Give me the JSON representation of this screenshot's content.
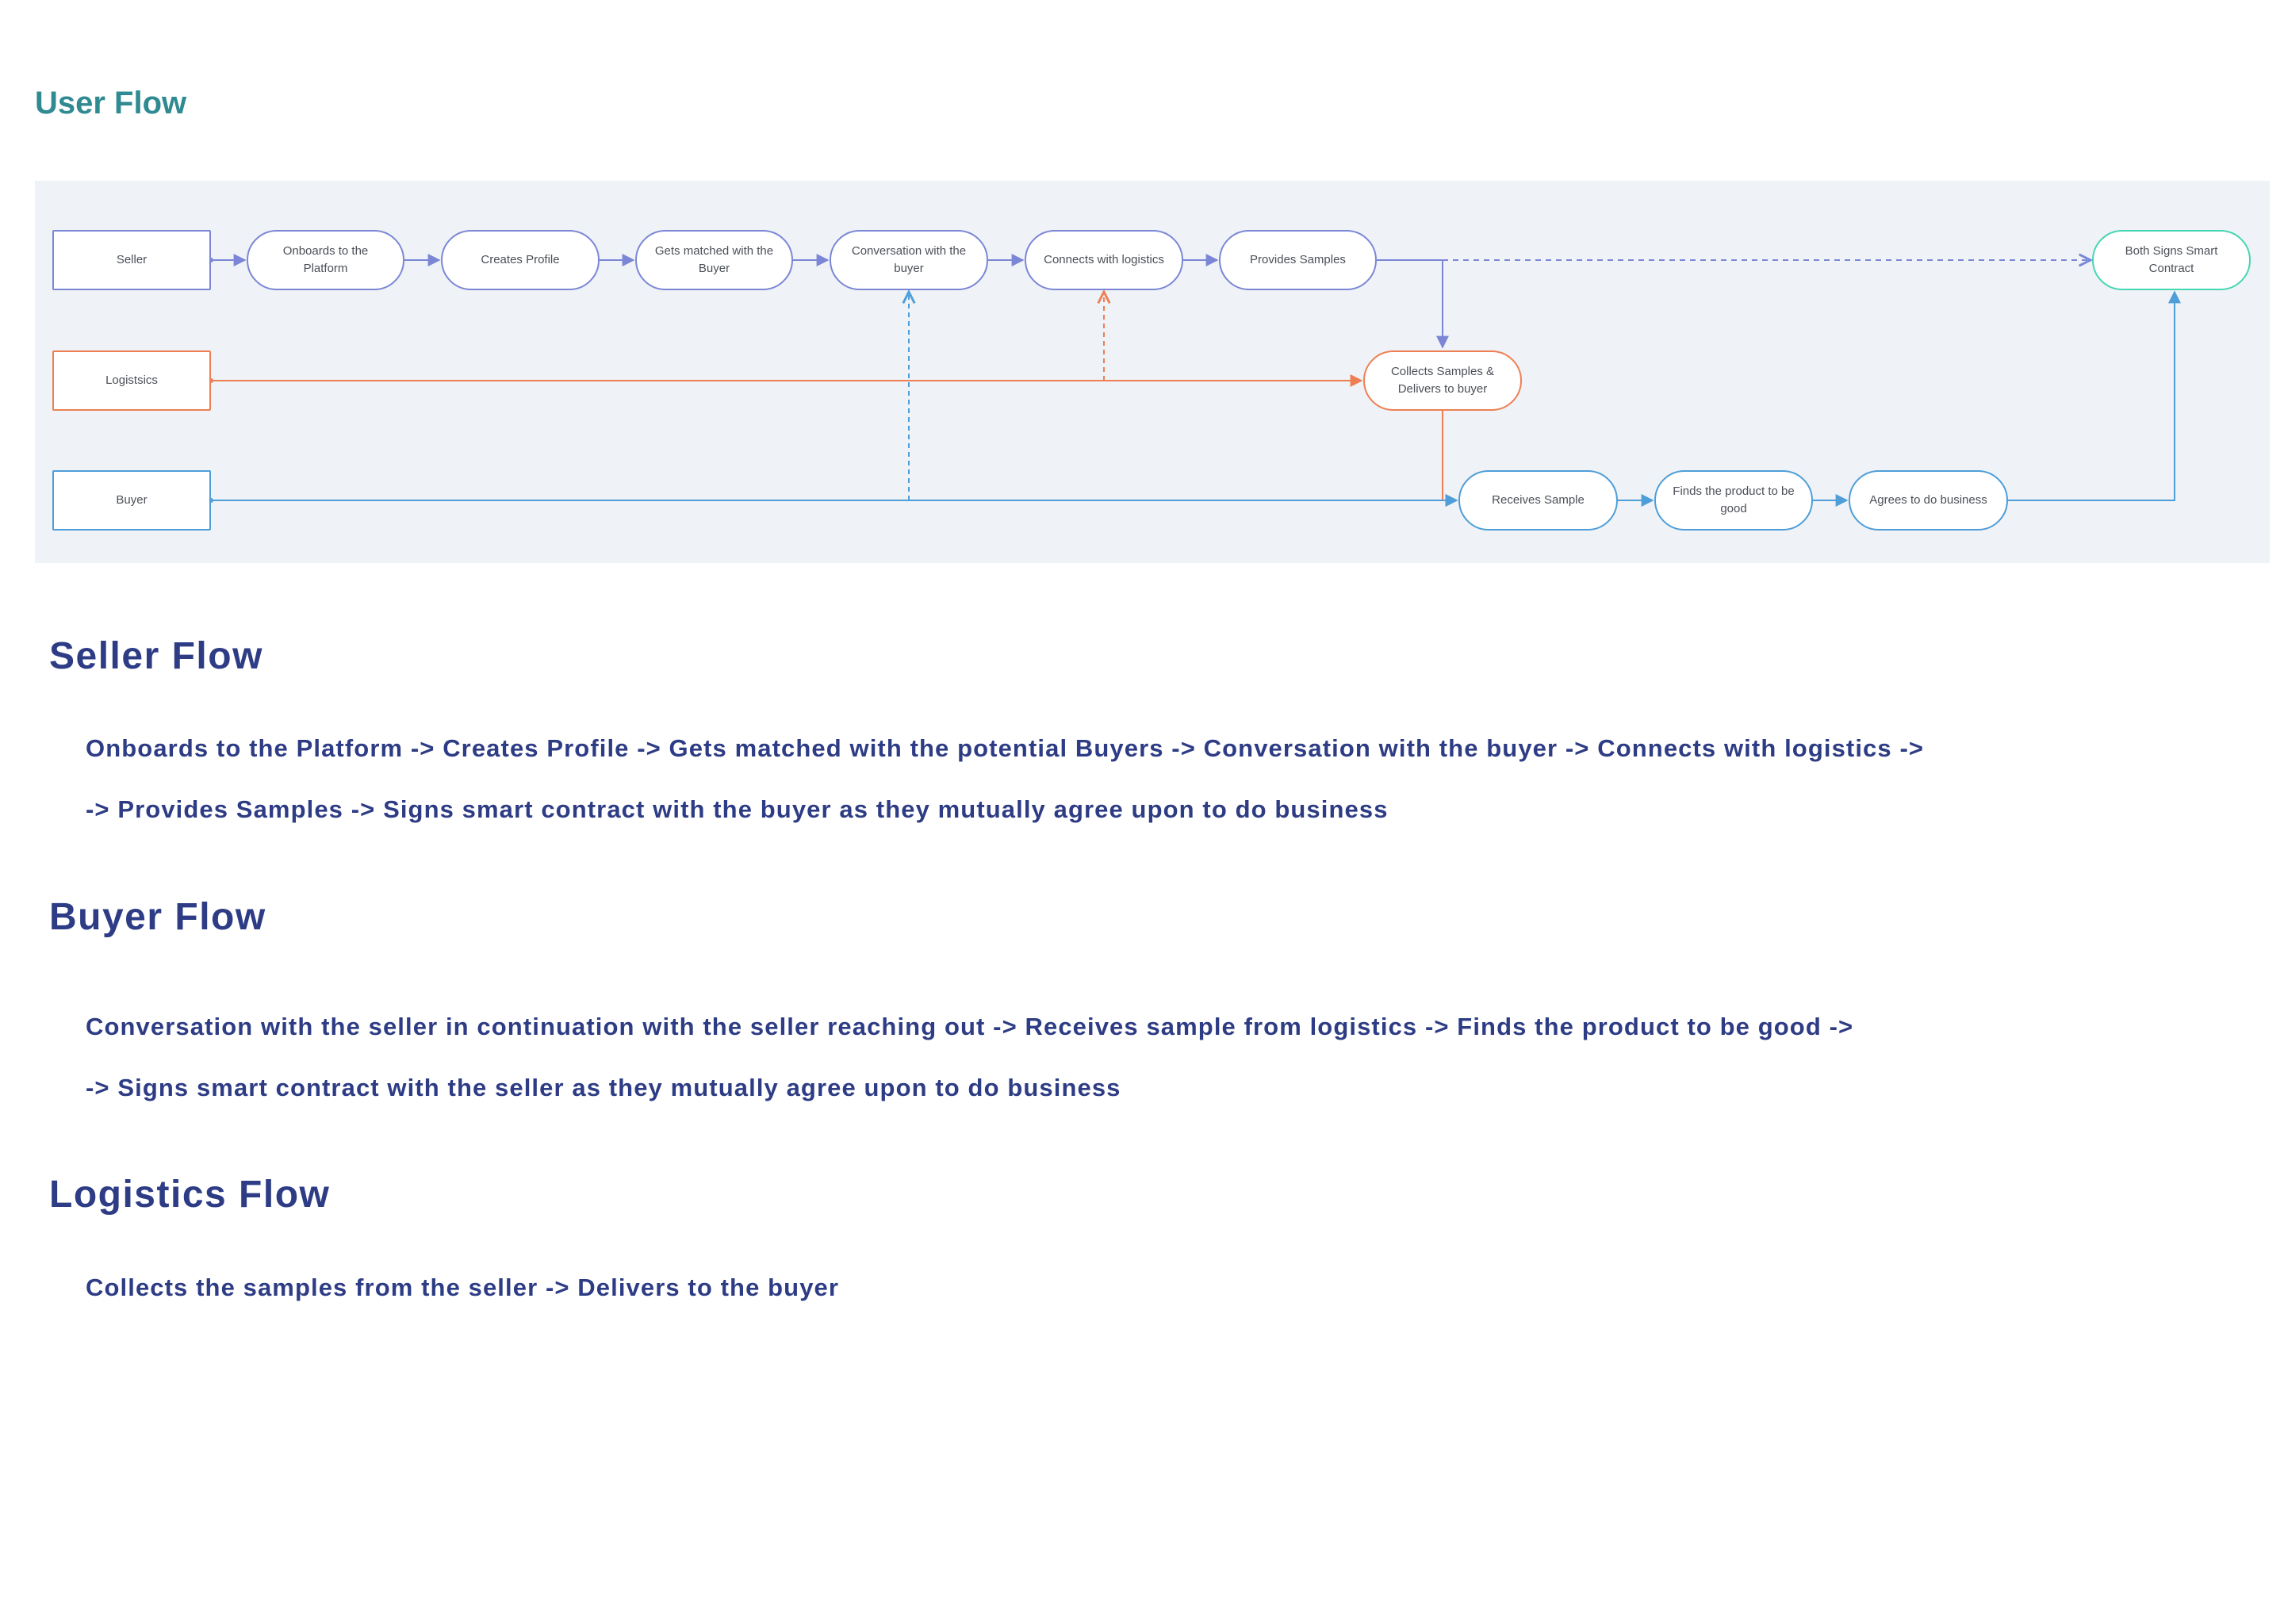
{
  "page_title": "User Flow",
  "colors": {
    "title": "#2f8a92",
    "heading": "#2d3c84",
    "panel": "#eff2f6",
    "seller": "#7b87d6",
    "logistics": "#ee7f54",
    "buyer": "#4e9ed9",
    "contract": "#45d6b4"
  },
  "diagram": {
    "lanes": {
      "seller": "Seller",
      "logistics": "Logistsics",
      "buyer": "Buyer"
    },
    "steps": {
      "onboards": "Onboards to the Platform",
      "creates_profile": "Creates Profile",
      "gets_matched": "Gets matched with the Buyer",
      "conversation": "Conversation with the buyer",
      "connects_logistics": "Connects with logistics",
      "provides_samples": "Provides Samples",
      "both_signs": "Both Signs Smart Contract",
      "collects_delivers": "Collects Samples & Delivers to buyer",
      "receives_sample": "Receives Sample",
      "finds_good": "Finds the product to be good",
      "agrees": "Agrees to do business"
    }
  },
  "sections": [
    {
      "title": "Seller Flow",
      "lines": [
        "Onboards to the Platform -> Creates Profile -> Gets matched with the potential Buyers -> Conversation with the buyer -> Connects with logistics ->",
        "-> Provides Samples -> Signs smart contract with the buyer as they mutually agree upon to do business"
      ]
    },
    {
      "title": "Buyer Flow",
      "lines": [
        "Conversation with the seller in continuation with the seller reaching out  -> Receives sample from logistics -> Finds the product to be good ->",
        " -> Signs smart contract with the seller as they mutually agree upon to do business"
      ]
    },
    {
      "title": "Logistics Flow",
      "lines": [
        "Collects the samples from the seller -> Delivers to the buyer"
      ]
    }
  ]
}
